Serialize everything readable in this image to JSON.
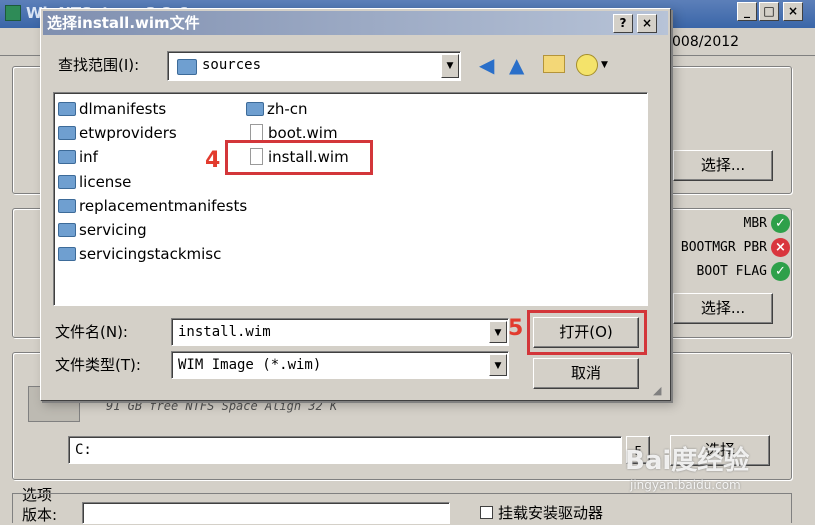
{
  "background_app": {
    "title": "WinNTSetup v3.2.6",
    "os_text": "008/2012",
    "select_label": "选择...",
    "status": {
      "mbr": "MBR",
      "bootmgr_pbr": "BOOTMGR PBR",
      "boot_flag": "BOOT FLAG"
    },
    "drive_info": "91 GB free NTFS Space Align 32 K",
    "drive_value": "C:",
    "drive_button": "F",
    "select_btn_3": "选择",
    "options_label": "选项",
    "version_label": "版本:",
    "checkbox_label": "挂载安装驱动器",
    "colors": {
      "ok": "#2ea04a",
      "error": "#d9363e"
    }
  },
  "dialog": {
    "title": "选择install.wim文件",
    "help_btn": "?",
    "close_btn": "×",
    "look_in_label": "查找范围(I):",
    "look_in_value": "sources",
    "toolbar_icons": [
      "back-arrow-icon",
      "up-folder-icon",
      "new-folder-icon",
      "view-menu-icon"
    ],
    "folders_col1": [
      "dlmanifests",
      "etwproviders",
      "inf",
      "license",
      "replacementmanifests",
      "servicing",
      "servicingstackmisc"
    ],
    "items_col2": [
      {
        "name": "zh-cn",
        "type": "folder"
      },
      {
        "name": "boot.wim",
        "type": "file"
      },
      {
        "name": "install.wim",
        "type": "file"
      }
    ],
    "filename_label": "文件名(N):",
    "filename_value": "install.wim",
    "filetype_label": "文件类型(T):",
    "filetype_value": "WIM Image (*.wim)",
    "open_button": "打开(O)",
    "cancel_button": "取消"
  },
  "annotations": {
    "step4": "4",
    "step5": "5",
    "color": "#e23b2e"
  },
  "watermark": {
    "brand": "Bai度经验",
    "url": "jingyan.baidu.com"
  }
}
